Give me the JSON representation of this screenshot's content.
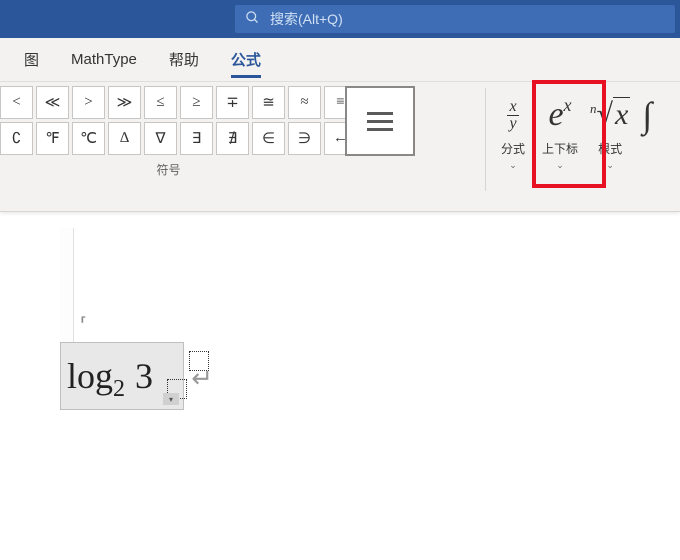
{
  "search": {
    "placeholder": "搜索(Alt+Q)"
  },
  "tabs": {
    "view": "图",
    "mathtype": "MathType",
    "help": "帮助",
    "equation": "公式"
  },
  "symbols": {
    "row1": [
      "<",
      "≪",
      ">",
      "≫",
      "≤",
      "≥",
      "∓",
      "≅",
      "≈",
      "≡"
    ],
    "row2": [
      "∁",
      "℉",
      "℃",
      "∆",
      "∇",
      "∃",
      "∄",
      "∈",
      "∋",
      "←"
    ],
    "group_label": "符号"
  },
  "structures": {
    "fraction": {
      "label": "分式"
    },
    "script": {
      "label": "上下标"
    },
    "radical": {
      "label": "根式"
    }
  },
  "equation": {
    "log": "log",
    "sub": "2",
    "arg": "3"
  }
}
